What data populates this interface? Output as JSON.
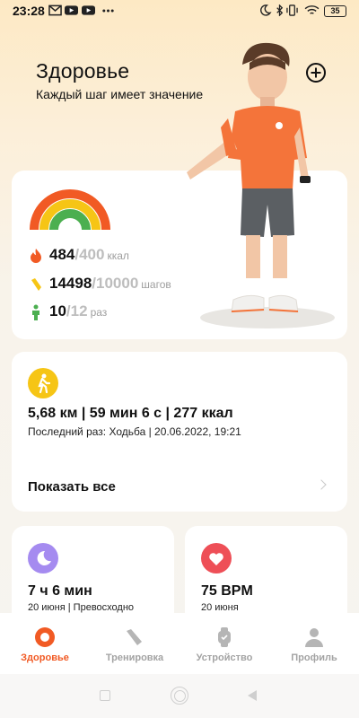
{
  "status_bar": {
    "time": "23:28",
    "left_icons": [
      "gmail-icon",
      "youtube-icon",
      "youtube-icon",
      "more-dots-icon"
    ],
    "right_icons": [
      "moon-icon",
      "bluetooth-icon",
      "vibrate-icon",
      "wifi-icon"
    ],
    "battery": "35"
  },
  "header": {
    "title": "Здоровье",
    "subtitle": "Каждый шаг имеет значение",
    "add_icon": "plus-circle-icon"
  },
  "activity": {
    "gauge_colors": [
      "#f15a24",
      "#f6c515",
      "#4caf50"
    ],
    "calories": {
      "value": "484",
      "goal": "/400",
      "unit": "ккал",
      "icon": "flame-icon",
      "color": "#f15a24",
      "progress": 1.0
    },
    "steps": {
      "value": "14498",
      "goal": "/10000",
      "unit": "шагов",
      "icon": "shoe-icon",
      "color": "#f6c515",
      "progress": 1.0
    },
    "stand": {
      "value": "10",
      "goal": "/12",
      "unit": "раз",
      "icon": "person-standing-icon",
      "color": "#4caf50",
      "progress": 0.83
    }
  },
  "workout": {
    "icon": "walking-icon",
    "summary": "5,68 км | 59 мин 6 с | 277 ккал",
    "last": "Последний раз: Ходьба | 20.06.2022, 19:21",
    "show_all": "Показать все"
  },
  "sleep": {
    "icon": "moon-icon",
    "value": "7 ч 6 мин",
    "sub": "20 июня | Превосходно"
  },
  "heart_rate": {
    "icon": "heart-icon",
    "value": "75 BPM",
    "sub": "20 июня"
  },
  "tabs": [
    {
      "label": "Здоровье",
      "icon": "health-ring-icon",
      "active": true
    },
    {
      "label": "Тренировка",
      "icon": "shoe-icon",
      "active": false
    },
    {
      "label": "Устройство",
      "icon": "watch-icon",
      "active": false
    },
    {
      "label": "Профиль",
      "icon": "user-icon",
      "active": false
    }
  ],
  "accent": "#f15a24"
}
